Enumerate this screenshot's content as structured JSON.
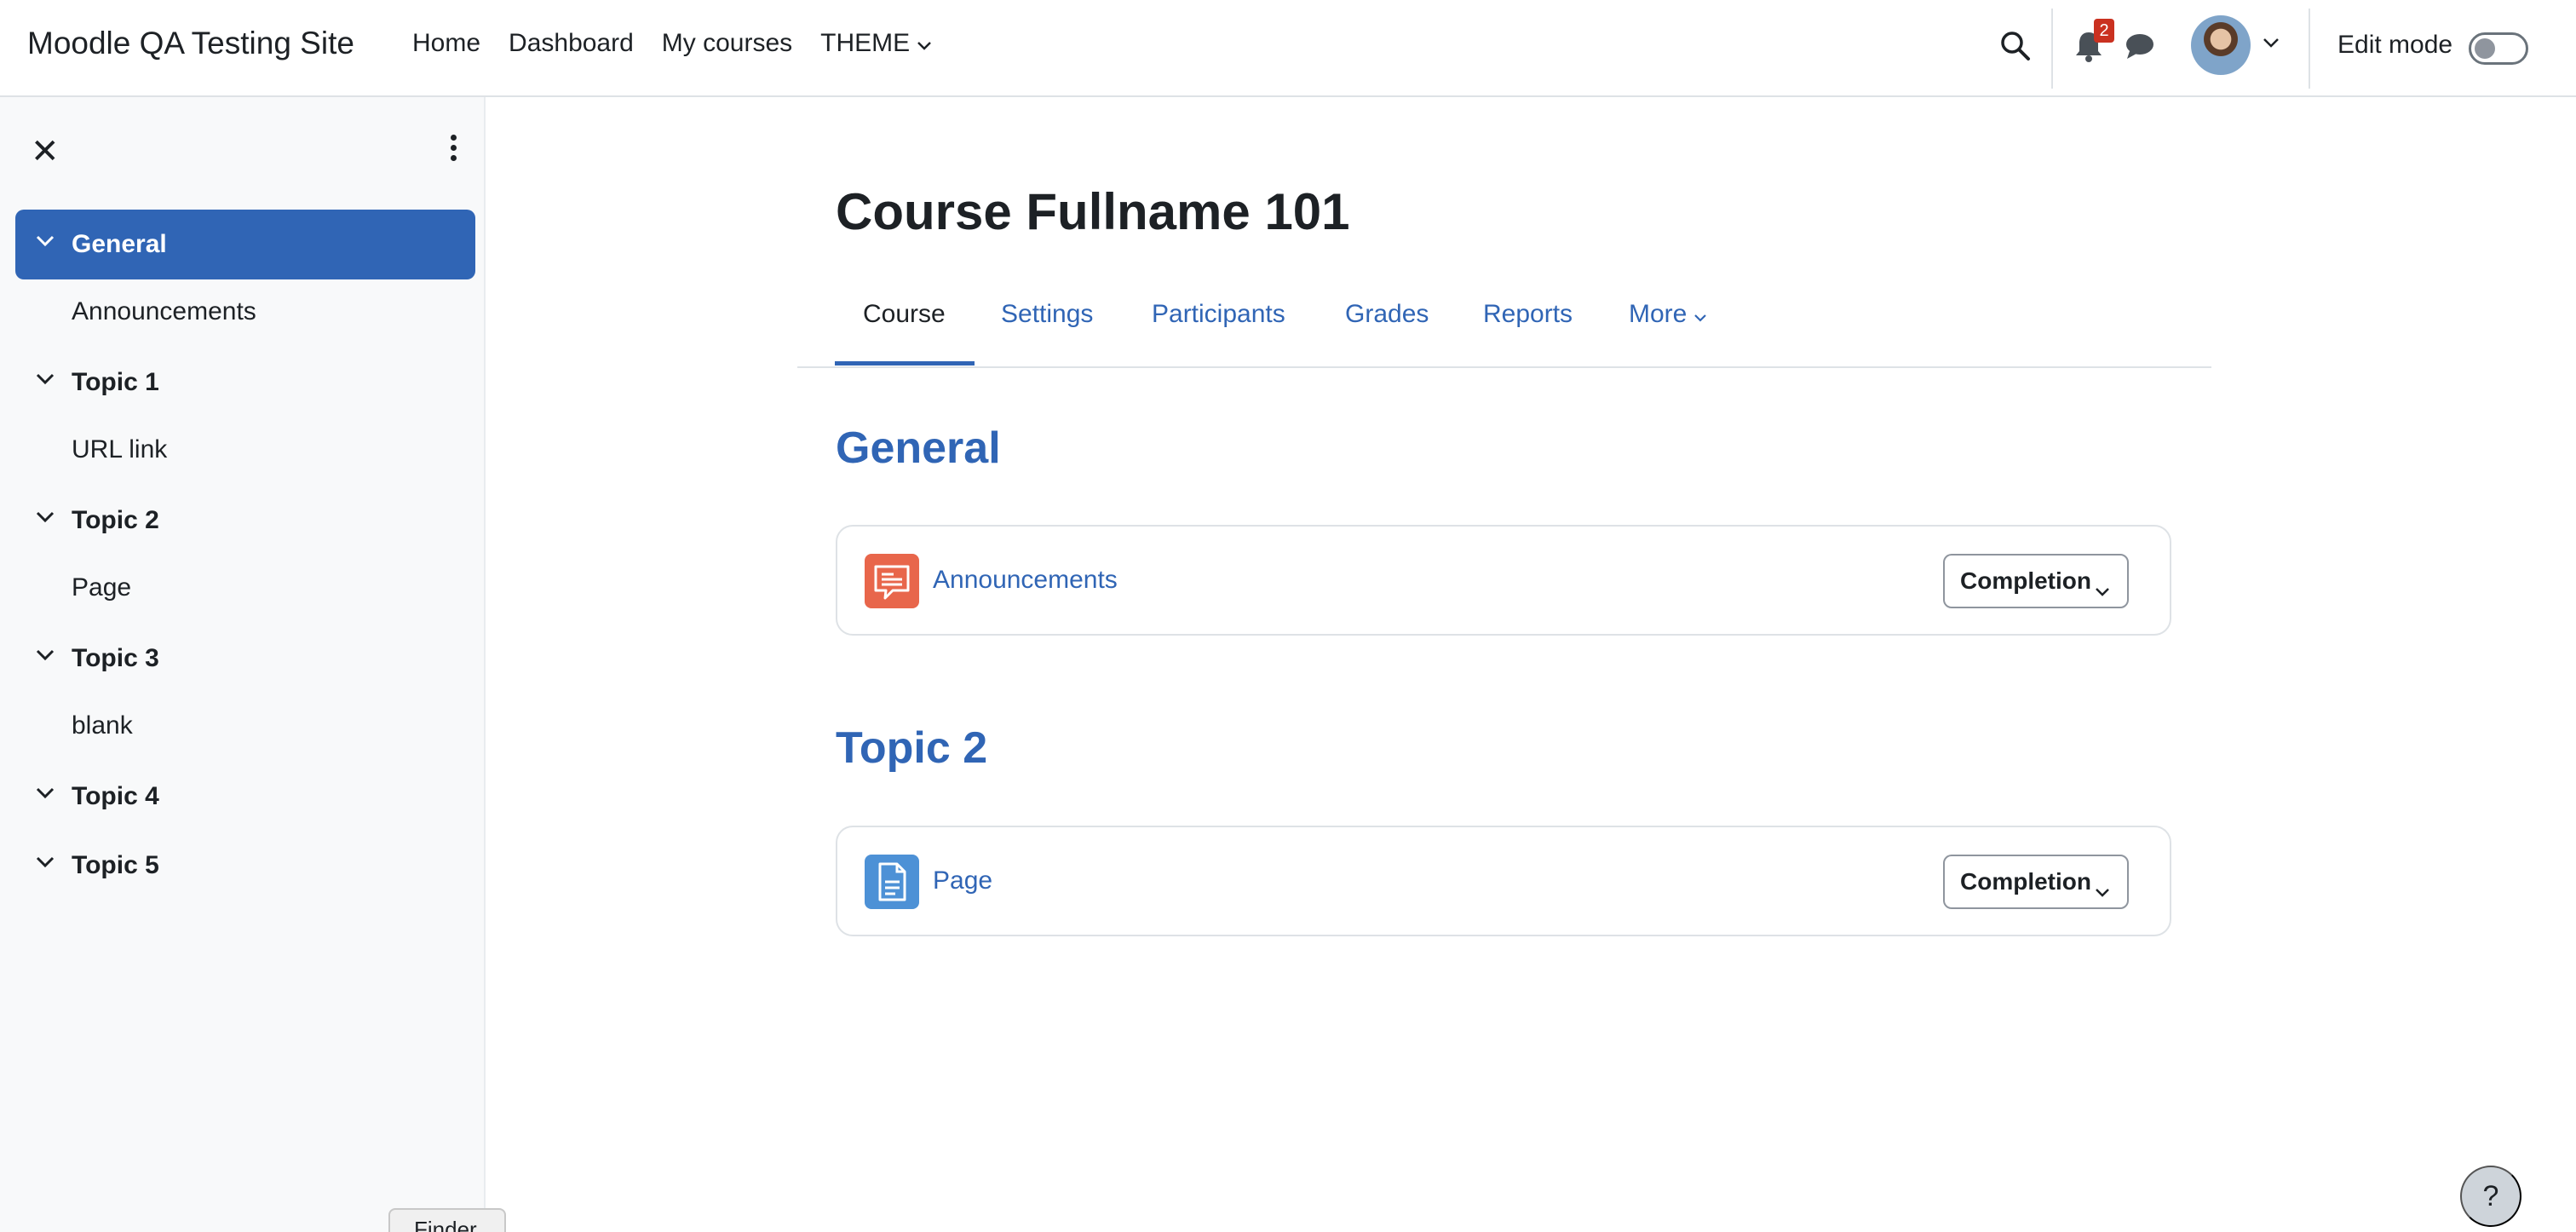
{
  "site": {
    "name": "Moodle QA Testing Site"
  },
  "primary_nav": [
    {
      "label": "Home"
    },
    {
      "label": "Dashboard"
    },
    {
      "label": "My courses"
    },
    {
      "label": "THEME"
    }
  ],
  "user_nav": {
    "notification_count": "2",
    "edit_mode_label": "Edit mode",
    "edit_mode_on": false
  },
  "course_index": {
    "items": [
      {
        "type": "section",
        "label": "General",
        "active": true
      },
      {
        "type": "activity",
        "label": "Announcements"
      },
      {
        "type": "section",
        "label": "Topic 1"
      },
      {
        "type": "activity",
        "label": "URL link"
      },
      {
        "type": "section",
        "label": "Topic 2"
      },
      {
        "type": "activity",
        "label": "Page"
      },
      {
        "type": "section",
        "label": "Topic 3"
      },
      {
        "type": "activity",
        "label": "blank"
      },
      {
        "type": "section",
        "label": "Topic 4"
      },
      {
        "type": "section",
        "label": "Topic 5"
      }
    ]
  },
  "course": {
    "title": "Course Fullname 101",
    "tabs": [
      {
        "label": "Course",
        "active": true
      },
      {
        "label": "Settings"
      },
      {
        "label": "Participants"
      },
      {
        "label": "Grades"
      },
      {
        "label": "Reports"
      },
      {
        "label": "More"
      }
    ],
    "sections": [
      {
        "title": "General",
        "activities": [
          {
            "name": "Announcements",
            "icon": "forum-icon",
            "icon_color": "#e8664b",
            "completion_label": "Completion"
          }
        ]
      },
      {
        "title": "Topic 2",
        "activities": [
          {
            "name": "Page",
            "icon": "page-icon",
            "icon_color": "#4d91d6",
            "completion_label": "Completion"
          }
        ]
      }
    ]
  },
  "help": {
    "label": "?"
  },
  "finder_tooltip": {
    "label": "Finder"
  },
  "colors": {
    "primary": "#3065b5",
    "text": "#1d2125",
    "badge": "#ca3120"
  }
}
